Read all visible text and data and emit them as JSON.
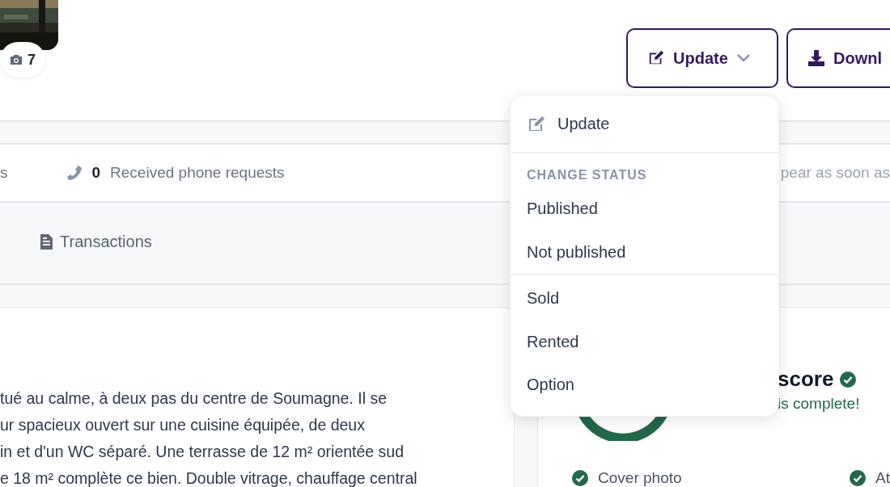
{
  "photo": {
    "kind": "picture",
    "count": "7"
  },
  "actions": [
    {
      "label": "Update",
      "kind": "dropdown",
      "open": true
    },
    {
      "label": "Downl",
      "kind": "download"
    }
  ],
  "stats": {
    "leading_fragment": "s",
    "phone_requests": {
      "count": "0",
      "label": "Received phone requests"
    },
    "note_fragment": "pear as soon as"
  },
  "tabs": [
    {
      "label": "Transactions",
      "selected": false
    }
  ],
  "description": {
    "lines": [
      "tué au calme, à deux pas du centre de Soumagne. Il se",
      "ur spacieux ouvert sur une cuisine équipée, de deux",
      "in et d'un WC séparé. Une terrasse de 12 m² orientée sud",
      "e 18 m² complète ce bien. Double vitrage, chauffage central"
    ]
  },
  "score": {
    "title": "score",
    "verified": true,
    "subtitle": "is complete!",
    "checklist": [
      {
        "label": "Cover photo",
        "done": true
      },
      {
        "label": "At",
        "done": true
      }
    ]
  },
  "dropdown": {
    "items": [
      {
        "kind": "action",
        "label": "Update"
      },
      {
        "kind": "divider"
      },
      {
        "kind": "header",
        "label": "CHANGE STATUS"
      },
      {
        "kind": "status",
        "label": "Published"
      },
      {
        "kind": "status",
        "label": "Not published"
      },
      {
        "kind": "divider"
      },
      {
        "kind": "status",
        "label": "Sold"
      },
      {
        "kind": "status",
        "label": "Rented"
      },
      {
        "kind": "status",
        "label": "Option"
      }
    ]
  }
}
